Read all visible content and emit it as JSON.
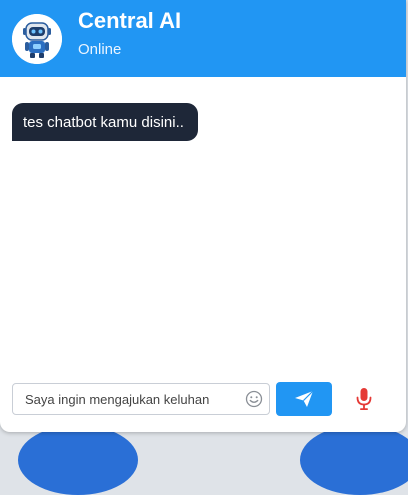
{
  "header": {
    "title": "Central AI",
    "status": "Online",
    "accent_color": "#2196f3",
    "avatar_icon": "robot-avatar-icon"
  },
  "messages": [
    {
      "text": "tes chatbot kamu disini..",
      "bubble_color": "#1e2738"
    }
  ],
  "composer": {
    "placeholder": "Saya ingin mengajukan keluhan",
    "value": "",
    "emoji_icon": "smiley-icon",
    "send_icon": "paper-plane-icon",
    "mic_icon": "microphone-icon",
    "mic_color": "#e53935"
  }
}
